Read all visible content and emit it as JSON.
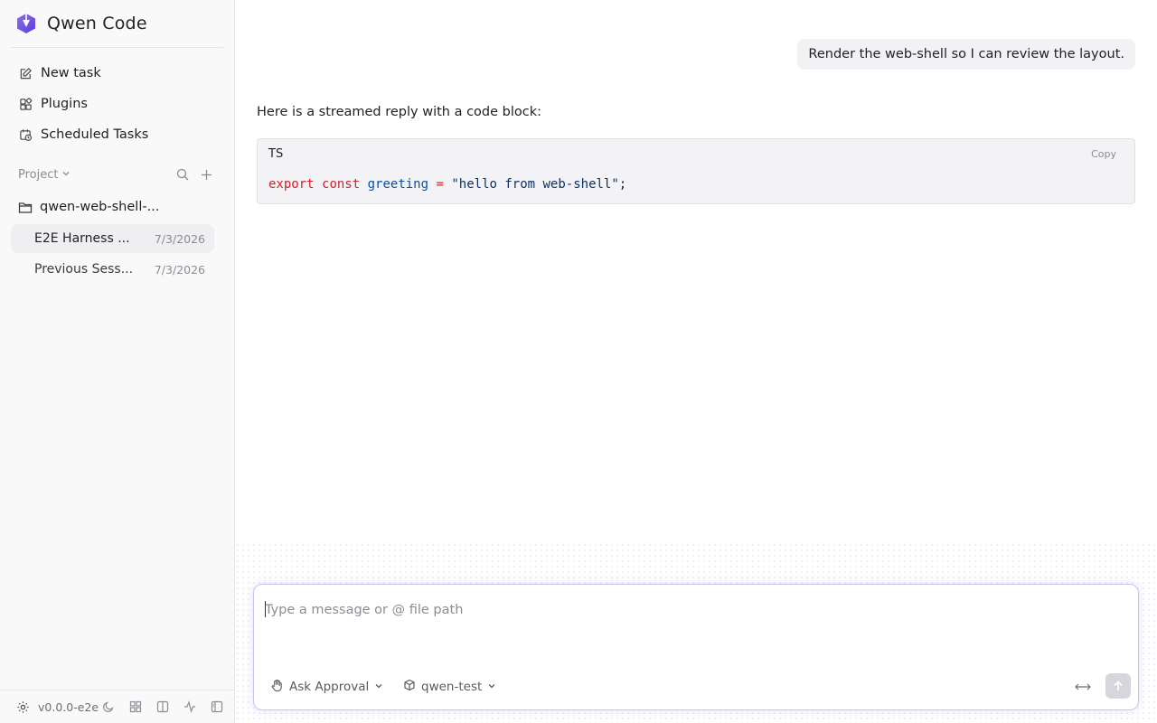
{
  "brand": {
    "title": "Qwen Code",
    "logo_icon": "qwen-logo-icon",
    "accent": "#6b4fe0"
  },
  "nav": [
    {
      "label": "New task",
      "icon": "edit-icon"
    },
    {
      "label": "Plugins",
      "icon": "plugins-icon"
    },
    {
      "label": "Scheduled Tasks",
      "icon": "calendar-clock-icon"
    }
  ],
  "project": {
    "label": "Project",
    "folder": "qwen-web-shell-...",
    "sessions": [
      {
        "name": "E2E Harness ...",
        "date": "7/3/2026",
        "active": true
      },
      {
        "name": "Previous Sess...",
        "date": "7/3/2026",
        "active": false
      }
    ]
  },
  "footer": {
    "version": "v0.0.0-e2e"
  },
  "chat": {
    "user_message": "Render the web-shell so I can review the layout.",
    "assistant_text": "Here is a streamed reply with a code block:",
    "code": {
      "lang": "TS",
      "copy_label": "Copy",
      "tokens": {
        "kw1": "export",
        "kw2": "const",
        "var": "greeting",
        "op": "=",
        "str": "\"hello from web-shell\"",
        "end": ";"
      }
    }
  },
  "composer": {
    "placeholder": "Type a message or @ file path",
    "value": "",
    "mode_label": "Ask Approval",
    "model_label": "qwen-test"
  }
}
